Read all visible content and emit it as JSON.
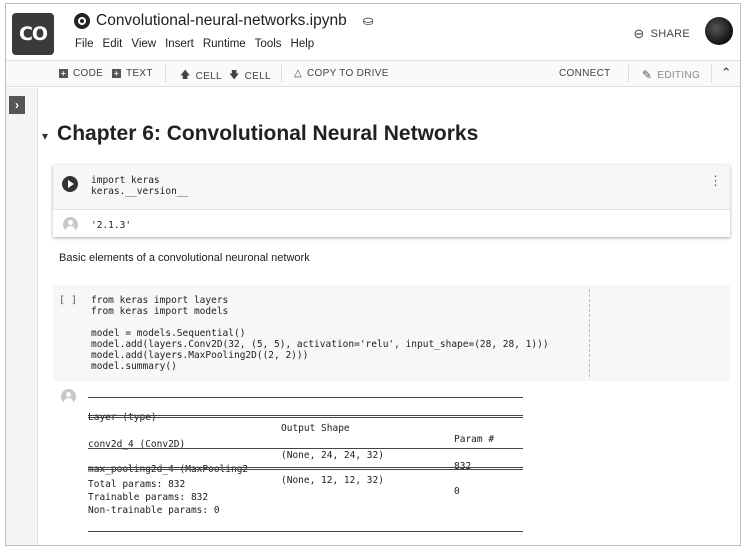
{
  "app": {
    "logo_text": "CO",
    "notebook_title": "Convolutional-neural-networks.ipynb",
    "share_label": "SHARE"
  },
  "menu": [
    "File",
    "Edit",
    "View",
    "Insert",
    "Runtime",
    "Tools",
    "Help"
  ],
  "toolbar": {
    "code_label": "CODE",
    "text_label": "TEXT",
    "cell_up_label": "CELL",
    "cell_down_label": "CELL",
    "copy_to_drive_label": "COPY TO DRIVE",
    "connect_label": "CONNECT",
    "editing_label": "EDITING"
  },
  "icons": {
    "github": "github-icon",
    "drive": "drive-icon",
    "link": "link-icon",
    "run": "play-icon",
    "output": "output-avatar-icon",
    "side_toggle": "chevron-right-icon",
    "collapse": "chevron-up-icon",
    "heading_caret": "caret-down-icon",
    "more": "more-vert-icon",
    "edit": "pencil-icon"
  },
  "heading": "Chapter 6: Convolutional Neural Networks",
  "cell1": {
    "code": "import keras\nkeras.__version__",
    "output": "'2.1.3'"
  },
  "text_cell": "Basic elements of a convolutional neuronal network",
  "cell2": {
    "bracket": "[ ]",
    "code": "from keras import layers\nfrom keras import models\n\nmodel = models.Sequential()\nmodel.add(layers.Conv2D(32, (5, 5), activation='relu', input_shape=(28, 28, 1)))\nmodel.add(layers.MaxPooling2D((2, 2)))\nmodel.summary()"
  },
  "summary": {
    "headers": [
      "Layer (type)",
      "Output Shape",
      "Param #"
    ],
    "rows": [
      [
        "conv2d_4 (Conv2D)",
        "(None, 24, 24, 32)",
        "832"
      ],
      [
        "max_pooling2d_4 (MaxPooling2",
        "(None, 12, 12, 32)",
        "0"
      ]
    ],
    "total": "Total params: 832",
    "trainable": "Trainable params: 832",
    "non_trainable": "Non-trainable params: 0"
  }
}
